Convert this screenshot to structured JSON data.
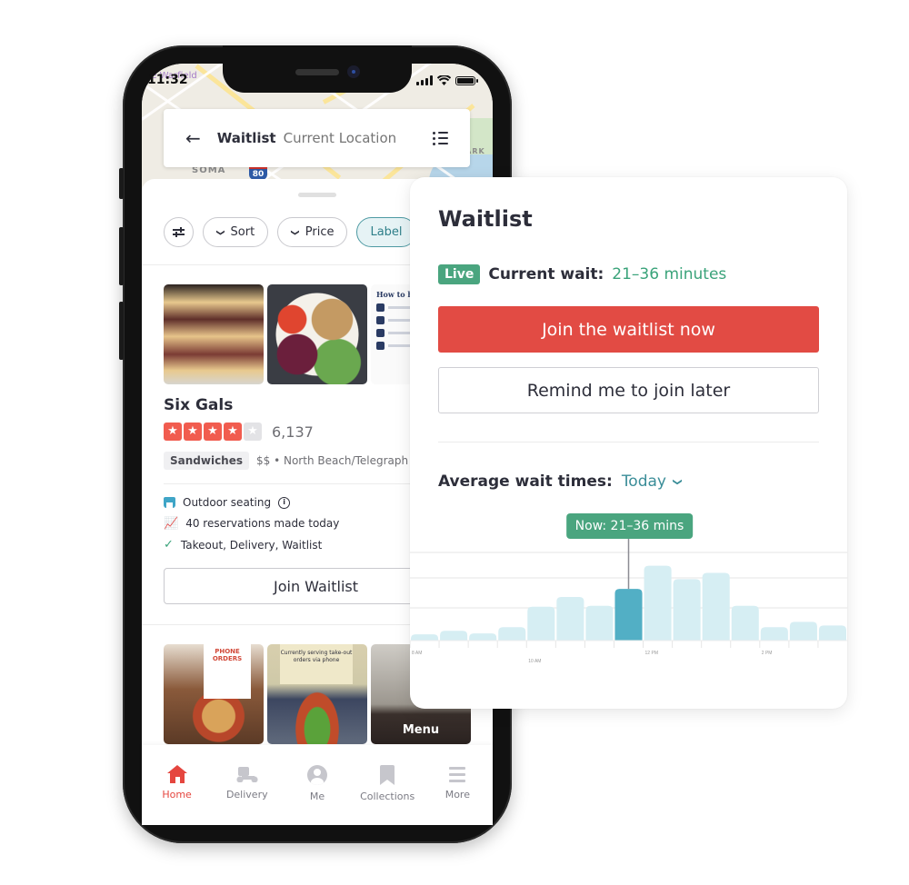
{
  "phone": {
    "status_bar": {
      "time": "11:32"
    },
    "map_labels": [
      "he Warfield",
      "SOMA",
      "PARK",
      "80"
    ],
    "search_bar": {
      "title": "Waitlist",
      "location": "Current Location"
    },
    "filters": [
      {
        "label": "",
        "icon": "sliders-icon"
      },
      {
        "label": "Sort",
        "icon": "chevron-down-icon"
      },
      {
        "label": "Price",
        "icon": "chevron-down-icon"
      },
      {
        "label": "Label",
        "active": true
      }
    ],
    "business": {
      "name": "Six Gals",
      "rating": 4,
      "rating_max": 5,
      "review_count": "6,137",
      "category": "Sandwiches",
      "price_location": "$$ • North Beach/Telegraph Hil",
      "features": [
        {
          "icon": "awning-icon",
          "text": "Outdoor seating",
          "info": true
        },
        {
          "icon": "trending-icon",
          "text": "40 reservations made today"
        },
        {
          "icon": "check-icon",
          "text": "Takeout, Delivery, Waitlist"
        }
      ],
      "join_button": "Join Waitlist",
      "guide_photo_title": "How to ha experience"
    },
    "second_listing": {
      "photo_signs": [
        "PHONE ORDERS",
        "Currently serving take-out orders via phone"
      ],
      "menu_label": "Menu"
    },
    "tab_bar": [
      {
        "label": "Home",
        "icon": "home-icon",
        "active": true
      },
      {
        "label": "Delivery",
        "icon": "scooter-icon"
      },
      {
        "label": "Me",
        "icon": "person-icon"
      },
      {
        "label": "Collections",
        "icon": "bookmark-icon"
      },
      {
        "label": "More",
        "icon": "menu-icon"
      }
    ]
  },
  "waitlist_card": {
    "title": "Waitlist",
    "live_badge": "Live",
    "current_wait_label": "Current wait:",
    "current_wait_value": "21–36 minutes",
    "primary_button": "Join the waitlist now",
    "secondary_button": "Remind me to join later",
    "average_label": "Average wait times:",
    "average_period": "Today",
    "tooltip": "Now: 21–36 mins"
  },
  "colors": {
    "brand_red": "#e24b44",
    "live_green": "#4aa57f",
    "link_teal": "#3a8d98",
    "bar": "#d6eef3",
    "bar_highlight": "#52afc5"
  },
  "chart_data": {
    "type": "bar",
    "title": "Average wait times",
    "xlabel": "",
    "ylabel": "",
    "grid": true,
    "tick_labels": [
      "8 AM",
      "10 AM",
      "12 PM",
      "2 PM"
    ],
    "tick_positions": [
      0,
      4,
      8,
      12
    ],
    "categories": [
      "8:00",
      "8:30",
      "9:00",
      "9:30",
      "10:00",
      "10:30",
      "11:00",
      "11:30",
      "12:00",
      "12:30",
      "13:00",
      "13:30",
      "14:00",
      "14:30",
      "15:00"
    ],
    "values": [
      7,
      11,
      8,
      15,
      38,
      49,
      39,
      58,
      84,
      69,
      76,
      39,
      15,
      21,
      17
    ],
    "highlight_index": 7,
    "ylim": [
      0,
      100
    ]
  }
}
